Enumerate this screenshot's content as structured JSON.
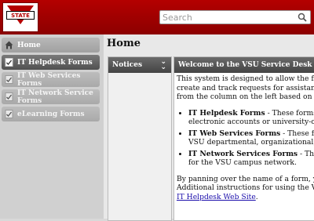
{
  "header": {
    "logo_text": "STATE",
    "search_placeholder": "Search"
  },
  "sidebar": {
    "items": [
      {
        "label": "Home"
      },
      {
        "label": "IT Helpdesk Forms"
      },
      {
        "label": "IT Web Services Forms"
      },
      {
        "label": "IT Network Service Forms"
      },
      {
        "label": "eLearning Forms"
      }
    ]
  },
  "main": {
    "title": "Home",
    "notices_title": "Notices",
    "welcome_title": "Welcome to the VSU Service Desk",
    "intro_lines": [
      "This system is designed to allow the faculty",
      "create and track requests for assistance. To",
      "from the column on the left based on the ty"
    ],
    "bullets": [
      {
        "title": "IT Helpdesk Forms",
        "text1": " - These forms",
        "text2": "electronic accounts or university-ow"
      },
      {
        "title": "IT Web Services Forms",
        "text1": " - These fo",
        "text2": "VSU departmental, organizational, or"
      },
      {
        "title": "IT Network Services Forms",
        "text1": " - Thes",
        "text2": "for the VSU campus network."
      }
    ],
    "outro_lines": [
      "By panning over the name of a form, you c",
      "Additional instructions for using the VSU Se"
    ],
    "outro_link": "IT Helpdesk Web Site",
    "outro_end": "."
  }
}
